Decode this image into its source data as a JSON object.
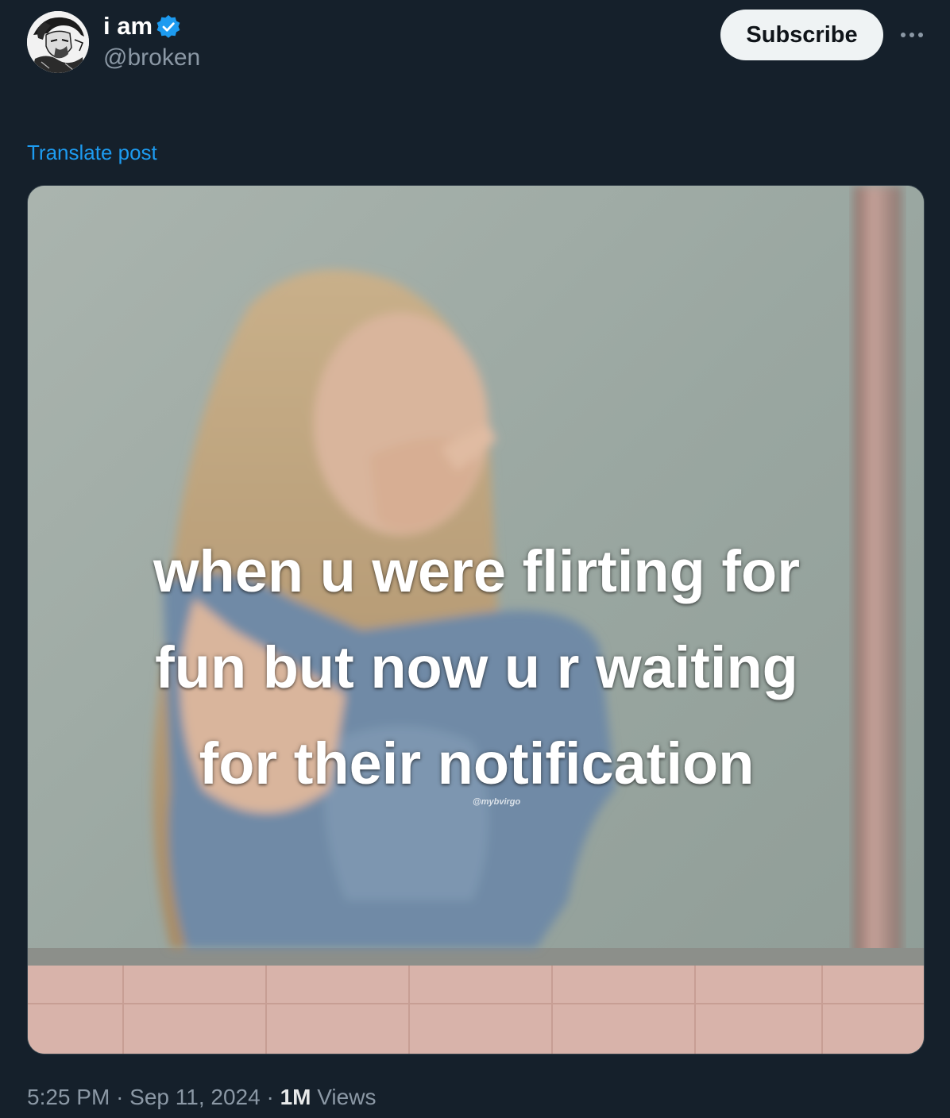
{
  "author": {
    "display_name": "i am",
    "handle": "@broken",
    "verified": true
  },
  "header": {
    "subscribe_label": "Subscribe"
  },
  "post": {
    "translate_label": "Translate post",
    "meme_caption_lines": [
      "when u were flirting for",
      "fun but now u r waiting",
      "for their notification"
    ],
    "watermark": "@mybvirgo"
  },
  "meta": {
    "time": "5:25 PM",
    "separator": "·",
    "date": "Sep 11, 2024",
    "views_count": "1M",
    "views_label": "Views"
  },
  "colors": {
    "background": "#15202b",
    "accent": "#1d9bf0",
    "secondary_text": "#8b98a5"
  }
}
